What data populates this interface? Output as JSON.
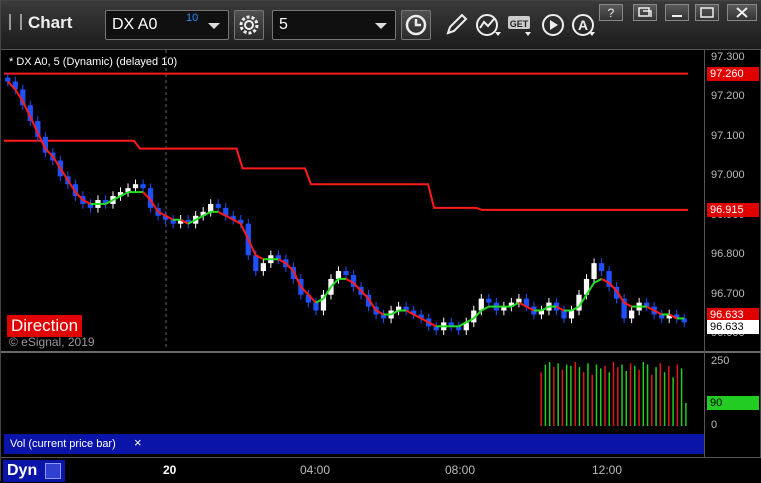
{
  "titlebar": {
    "title": "Chart",
    "symbol": "DX A0",
    "symbol_superscript": "10",
    "interval": "5"
  },
  "chart": {
    "study_name": "* DX A0, 5 (Dynamic) (delayed 10)",
    "direction_label": "Direction",
    "copyright": "© eSignal, 2019",
    "y_ticks": [
      "97.300",
      "97.200",
      "97.100",
      "97.000",
      "96.900",
      "96.800",
      "96.700",
      "96.600"
    ],
    "price_labels": {
      "upper_line": "97.260",
      "mid_line": "96.915",
      "current_red": "96.633",
      "current": "96.633"
    },
    "colors": {
      "up_candle": "#ffffff",
      "down_candle": "#1e50ff",
      "ma_down": "#ff1a1a",
      "ma_up": "#22dd22",
      "level_line": "#ff1a1a"
    }
  },
  "chart_data": {
    "type": "candlestick",
    "ylim": [
      96.56,
      97.32
    ],
    "x_labels": [
      "20",
      "04:00",
      "08:00",
      "12:00"
    ],
    "closes": [
      97.24,
      97.22,
      97.18,
      97.14,
      97.1,
      97.06,
      97.04,
      97.0,
      96.98,
      96.95,
      96.93,
      96.92,
      96.94,
      96.93,
      96.95,
      96.96,
      96.97,
      96.98,
      96.97,
      96.92,
      96.9,
      96.89,
      96.88,
      96.89,
      96.88,
      96.9,
      96.91,
      96.93,
      96.92,
      96.9,
      96.89,
      96.88,
      96.8,
      96.76,
      96.78,
      96.8,
      96.79,
      96.77,
      96.74,
      96.7,
      96.68,
      96.66,
      96.7,
      96.74,
      96.76,
      96.75,
      96.72,
      96.7,
      96.67,
      96.65,
      96.64,
      96.66,
      96.67,
      96.66,
      96.65,
      96.64,
      96.62,
      96.61,
      96.63,
      96.62,
      96.61,
      96.63,
      96.66,
      96.69,
      96.68,
      96.66,
      96.67,
      96.68,
      96.69,
      96.67,
      96.65,
      96.66,
      96.68,
      96.66,
      96.64,
      96.66,
      96.7,
      96.74,
      96.78,
      96.76,
      96.72,
      96.69,
      96.64,
      96.66,
      96.68,
      96.67,
      96.65,
      96.64,
      96.65,
      96.64,
      96.63
    ],
    "ma": [
      97.24,
      97.22,
      97.19,
      97.15,
      97.11,
      97.07,
      97.05,
      97.02,
      96.99,
      96.96,
      96.94,
      96.93,
      96.93,
      96.93,
      96.94,
      96.95,
      96.96,
      96.96,
      96.96,
      96.94,
      96.91,
      96.9,
      96.89,
      96.89,
      96.88,
      96.89,
      96.9,
      96.91,
      96.91,
      96.9,
      96.89,
      96.88,
      96.84,
      96.8,
      96.79,
      96.79,
      96.79,
      96.78,
      96.76,
      96.72,
      96.7,
      96.68,
      96.69,
      96.72,
      96.74,
      96.74,
      96.73,
      96.71,
      96.69,
      96.66,
      96.65,
      96.65,
      96.66,
      96.66,
      96.65,
      96.64,
      96.63,
      96.62,
      96.62,
      96.62,
      96.62,
      96.63,
      96.64,
      96.66,
      96.67,
      96.67,
      96.67,
      96.67,
      96.68,
      96.67,
      96.66,
      96.66,
      96.67,
      96.67,
      96.66,
      96.66,
      96.67,
      96.7,
      96.73,
      96.74,
      96.73,
      96.71,
      96.68,
      96.67,
      96.67,
      96.67,
      96.66,
      96.65,
      96.65,
      96.64,
      96.64
    ],
    "level_upper": 97.26,
    "level_mid_steps": [
      [
        0,
        97.09
      ],
      [
        0.19,
        97.07
      ],
      [
        0.34,
        97.02
      ],
      [
        0.44,
        96.98
      ],
      [
        0.62,
        96.92
      ],
      [
        0.69,
        96.915
      ]
    ],
    "volume": {
      "ylim": [
        0,
        250
      ],
      "y_ticks": [
        "250",
        "0"
      ],
      "current_label": "90",
      "values": [
        210,
        240,
        250,
        230,
        245,
        220,
        240,
        235,
        250,
        230,
        210,
        245,
        200,
        240,
        225,
        235,
        210,
        250,
        230,
        240,
        215,
        245,
        235,
        220,
        250,
        240,
        200,
        230,
        245,
        210,
        235,
        190,
        240,
        225,
        90
      ],
      "up": [
        0,
        1,
        1,
        0,
        1,
        0,
        1,
        1,
        0,
        1,
        0,
        1,
        0,
        1,
        1,
        0,
        1,
        0,
        0,
        1,
        1,
        0,
        1,
        0,
        1,
        1,
        0,
        1,
        0,
        1,
        0,
        1,
        0,
        1,
        1
      ]
    }
  },
  "volume_pane": {
    "label": "Vol (current price bar)",
    "close": "×"
  },
  "bottom": {
    "dyn_label": "Dyn"
  }
}
